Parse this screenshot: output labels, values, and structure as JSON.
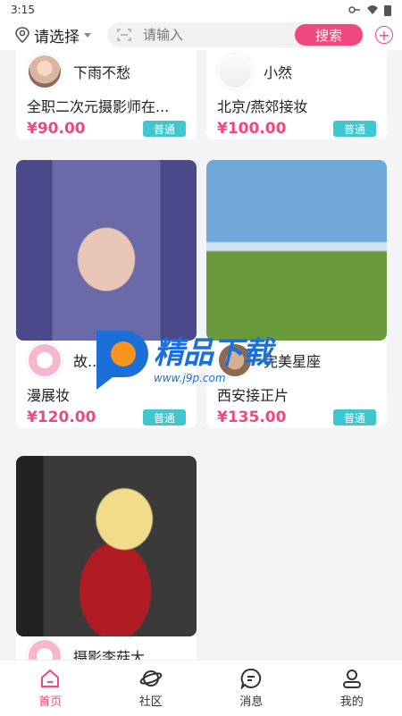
{
  "status": {
    "time": "3:15"
  },
  "header": {
    "location_label": "请选择",
    "search_placeholder": "请输入",
    "search_button": "搜索"
  },
  "cards": [
    {
      "username": "下雨不愁",
      "title": "全职二次元摄影师在...",
      "price": "¥90.00",
      "badge": "普通"
    },
    {
      "username": "小然",
      "title": "北京/燕郊接妆",
      "price": "¥100.00",
      "badge": "普通"
    },
    {
      "username": "故...",
      "title": "漫展妆",
      "price": "¥120.00",
      "badge": "普通"
    },
    {
      "username": "完美星座",
      "title": "西安接正片",
      "price": "¥135.00",
      "badge": "普通"
    },
    {
      "username": "摄影李菇大",
      "title": "",
      "price": "",
      "badge": ""
    }
  ],
  "watermark": {
    "text": "精品下载",
    "url": "www.j9p.com"
  },
  "nav": [
    {
      "label": "首页",
      "active": true
    },
    {
      "label": "社区",
      "active": false
    },
    {
      "label": "消息",
      "active": false
    },
    {
      "label": "我的",
      "active": false
    }
  ],
  "colors": {
    "accent": "#f0487e",
    "badge": "#3ec7cf"
  }
}
